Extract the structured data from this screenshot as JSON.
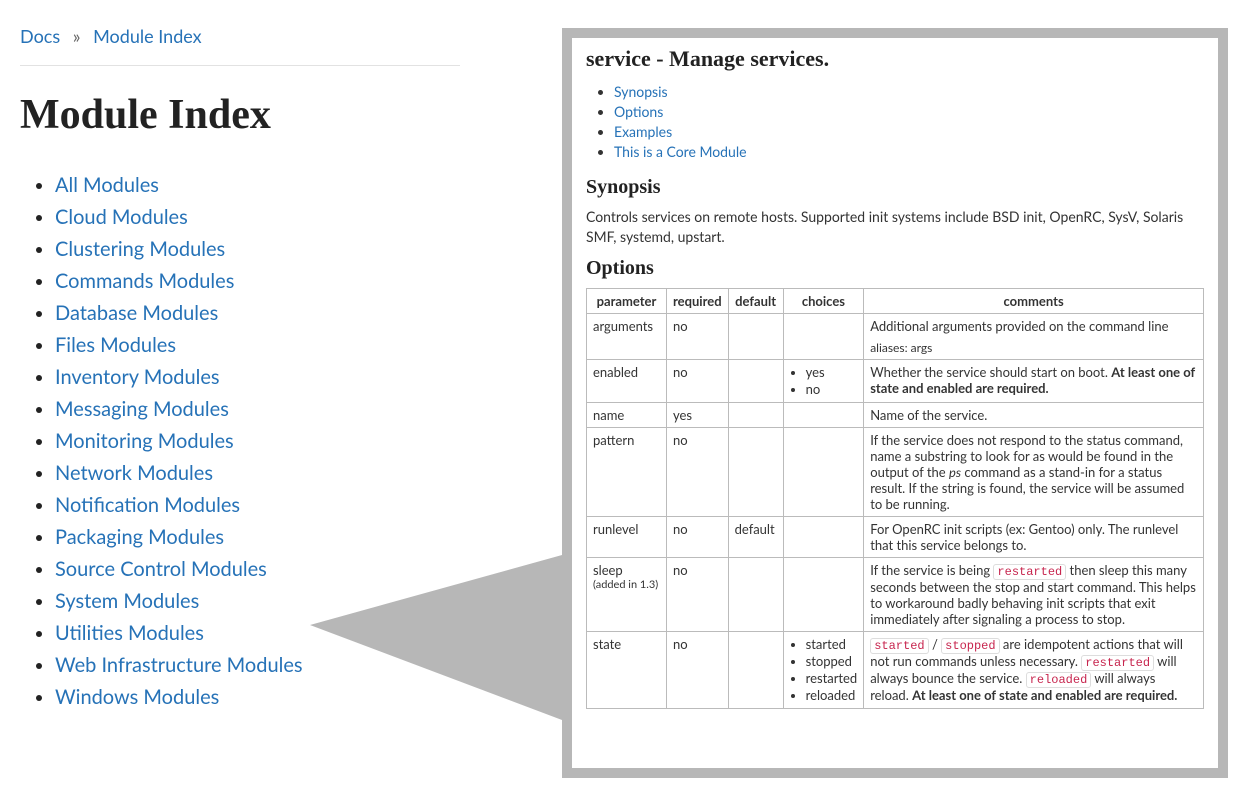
{
  "breadcrumb": {
    "root": "Docs",
    "sep": "»",
    "current": "Module Index"
  },
  "page_title": "Module Index",
  "module_categories": [
    "All Modules",
    "Cloud Modules",
    "Clustering Modules",
    "Commands Modules",
    "Database Modules",
    "Files Modules",
    "Inventory Modules",
    "Messaging Modules",
    "Monitoring Modules",
    "Network Modules",
    "Notification Modules",
    "Packaging Modules",
    "Source Control Modules",
    "System Modules",
    "Utilities Modules",
    "Web Infrastructure Modules",
    "Windows Modules"
  ],
  "detail": {
    "title": "service - Manage services.",
    "toc": [
      "Synopsis",
      "Options",
      "Examples",
      "This is a Core Module"
    ],
    "synopsis_heading": "Synopsis",
    "synopsis_text": "Controls services on remote hosts. Supported init systems include BSD init, OpenRC, SysV, Solaris SMF, systemd, upstart.",
    "options_heading": "Options",
    "columns": {
      "parameter": "parameter",
      "required": "required",
      "default": "default",
      "choices": "choices",
      "comments": "comments"
    },
    "rows": {
      "arguments": {
        "param": "arguments",
        "required": "no",
        "default": "",
        "choices": [],
        "comment_plain": "Additional arguments provided on the command line",
        "aliases": "aliases: args"
      },
      "enabled": {
        "param": "enabled",
        "required": "no",
        "default": "",
        "choices": [
          "yes",
          "no"
        ],
        "comment_pre": "Whether the service should start on boot. ",
        "comment_bold": "At least one of state and enabled are required."
      },
      "name": {
        "param": "name",
        "required": "yes",
        "default": "",
        "choices": [],
        "comment_plain": "Name of the service."
      },
      "pattern": {
        "param": "pattern",
        "required": "no",
        "default": "",
        "choices": [],
        "comment_pre": "If the service does not respond to the status command, name a substring to look for as would be found in the output of the ",
        "ps": "ps",
        "comment_post": " command as a stand-in for a status result. If the string is found, the service will be assumed to be running."
      },
      "runlevel": {
        "param": "runlevel",
        "required": "no",
        "default": "default",
        "choices": [],
        "comment_plain": "For OpenRC init scripts (ex: Gentoo) only. The runlevel that this service belongs to."
      },
      "sleep": {
        "param": "sleep",
        "added_in": "(added in 1.3)",
        "required": "no",
        "default": "",
        "choices": [],
        "comment_pre": "If the service is being ",
        "code1": "restarted",
        "comment_post": " then sleep this many seconds between the stop and start command. This helps to workaround badly behaving init scripts that exit immediately after signaling a process to stop."
      },
      "state": {
        "param": "state",
        "required": "no",
        "default": "",
        "choices": [
          "started",
          "stopped",
          "restarted",
          "reloaded"
        ],
        "code1": "started",
        "sep1": " / ",
        "code2": "stopped",
        "mid1": " are idempotent actions that will not run commands unless necessary. ",
        "code3": "restarted",
        "mid2": " will always bounce the service. ",
        "code4": "reloaded",
        "mid3": " will always reload. ",
        "bold": "At least one of state and enabled are required."
      }
    }
  }
}
